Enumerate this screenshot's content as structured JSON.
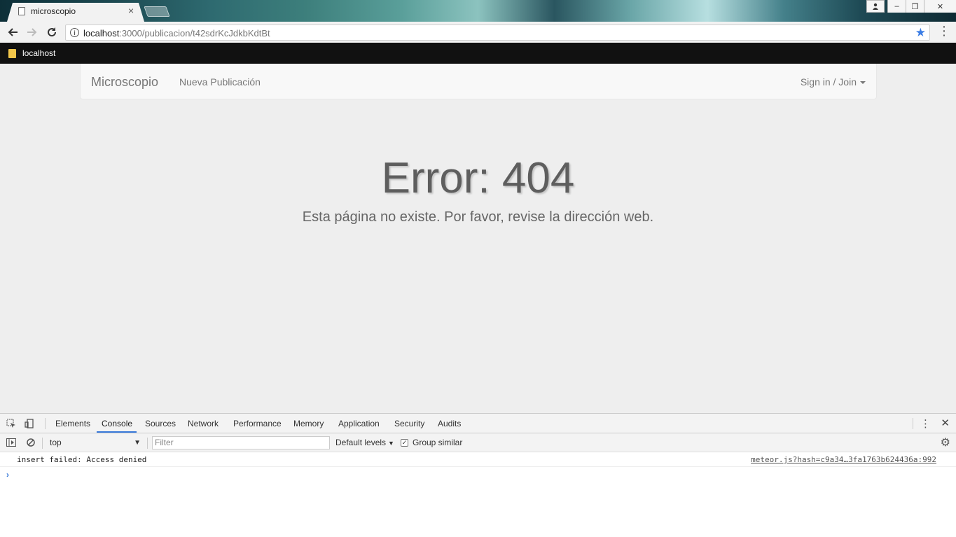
{
  "browser": {
    "tab_title": "microscopio",
    "url_host": "localhost",
    "url_path": ":3000/publicacion/t42sdrKcJdkbKdtBt",
    "bookmark_label": "localhost"
  },
  "site": {
    "brand": "Microscopio",
    "nav_new_post": "Nueva Publicación",
    "sign_in": "Sign in / Join",
    "error_title": "Error: 404",
    "error_message": "Esta página no existe. Por favor, revise la dirección web."
  },
  "devtools": {
    "tabs": [
      "Elements",
      "Console",
      "Sources",
      "Network",
      "Performance",
      "Memory",
      "Application",
      "Security",
      "Audits"
    ],
    "active_tab": "Console",
    "context": "top",
    "filter_placeholder": "Filter",
    "levels": "Default levels",
    "group_similar": "Group similar",
    "console_message": "insert failed: Access denied",
    "console_source": "meteor.js?hash=c9a34…3fa1763b624436a:992"
  },
  "colors": {
    "accent": "#3879d9",
    "star": "#3b7de5",
    "folder": "#f3c64a"
  }
}
